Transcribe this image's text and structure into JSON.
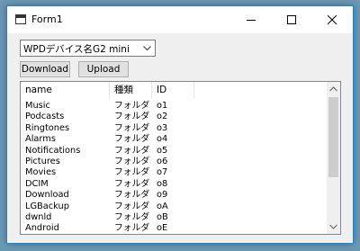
{
  "window": {
    "title": "Form1",
    "minimize_icon": "minimize-icon",
    "maximize_icon": "maximize-icon",
    "close_icon": "close-icon"
  },
  "device_combo": {
    "selected": "WPDデバイス名G2 mini",
    "icon": "chevron-down-icon"
  },
  "toolbar": {
    "download_label": "Download",
    "upload_label": "Upload"
  },
  "list": {
    "columns": [
      "name",
      "種類",
      "ID"
    ],
    "rows": [
      {
        "name": "Music",
        "type": "フォルダ",
        "id": "o1"
      },
      {
        "name": "Podcasts",
        "type": "フォルダ",
        "id": "o2"
      },
      {
        "name": "Ringtones",
        "type": "フォルダ",
        "id": "o3"
      },
      {
        "name": "Alarms",
        "type": "フォルダ",
        "id": "o4"
      },
      {
        "name": "Notifications",
        "type": "フォルダ",
        "id": "o5"
      },
      {
        "name": "Pictures",
        "type": "フォルダ",
        "id": "o6"
      },
      {
        "name": "Movies",
        "type": "フォルダ",
        "id": "o7"
      },
      {
        "name": "DCIM",
        "type": "フォルダ",
        "id": "o8"
      },
      {
        "name": "Download",
        "type": "フォルダ",
        "id": "o9"
      },
      {
        "name": "LGBackup",
        "type": "フォルダ",
        "id": "oA"
      },
      {
        "name": "dwnld",
        "type": "フォルダ",
        "id": "oB"
      },
      {
        "name": "Android",
        "type": "フォルダ",
        "id": "oE"
      }
    ]
  },
  "colors": {
    "desktop": "#6b9ab6",
    "window_border": "#1883d7",
    "window_bg": "#f0f0f0"
  }
}
